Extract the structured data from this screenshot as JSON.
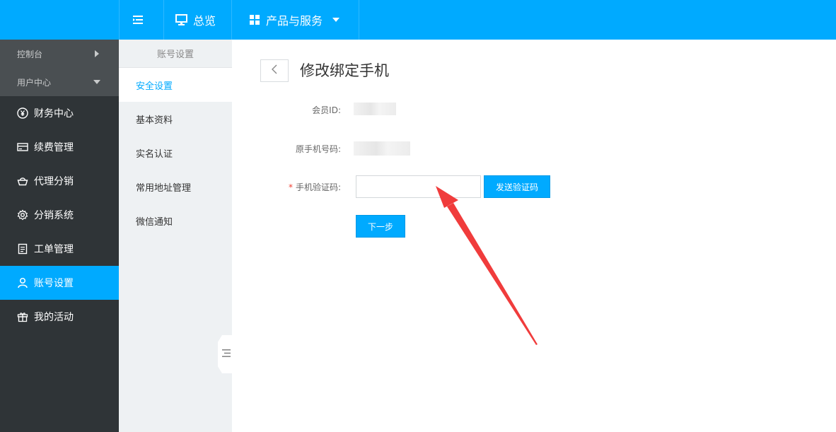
{
  "topbar": {
    "overview_label": "总览",
    "products_label": "产品与服务"
  },
  "sidebar": {
    "console_label": "控制台",
    "user_center_label": "用户中心",
    "items": [
      {
        "label": "财务中心",
        "icon": "yen-circle-icon"
      },
      {
        "label": "续费管理",
        "icon": "card-icon"
      },
      {
        "label": "代理分销",
        "icon": "basket-icon"
      },
      {
        "label": "分销系统",
        "icon": "gear-icon"
      },
      {
        "label": "工单管理",
        "icon": "document-icon"
      },
      {
        "label": "账号设置",
        "icon": "user-icon",
        "active": true
      },
      {
        "label": "我的活动",
        "icon": "gift-icon"
      }
    ]
  },
  "subnav": {
    "title": "账号设置",
    "items": [
      {
        "label": "安全设置",
        "active": true
      },
      {
        "label": "基本资料"
      },
      {
        "label": "实名认证"
      },
      {
        "label": "常用地址管理"
      },
      {
        "label": "微信通知"
      }
    ]
  },
  "main": {
    "title": "修改绑定手机",
    "member_id_label": "会员ID:",
    "orig_phone_label": "原手机号码:",
    "required_mark": "*",
    "code_label": "手机验证码:",
    "code_value": "",
    "send_code_label": "发送验证码",
    "next_label": "下一步"
  },
  "colors": {
    "accent": "#00aaff",
    "sidebar_bg": "#2f3437",
    "annotation_arrow": "#f03c3c"
  }
}
